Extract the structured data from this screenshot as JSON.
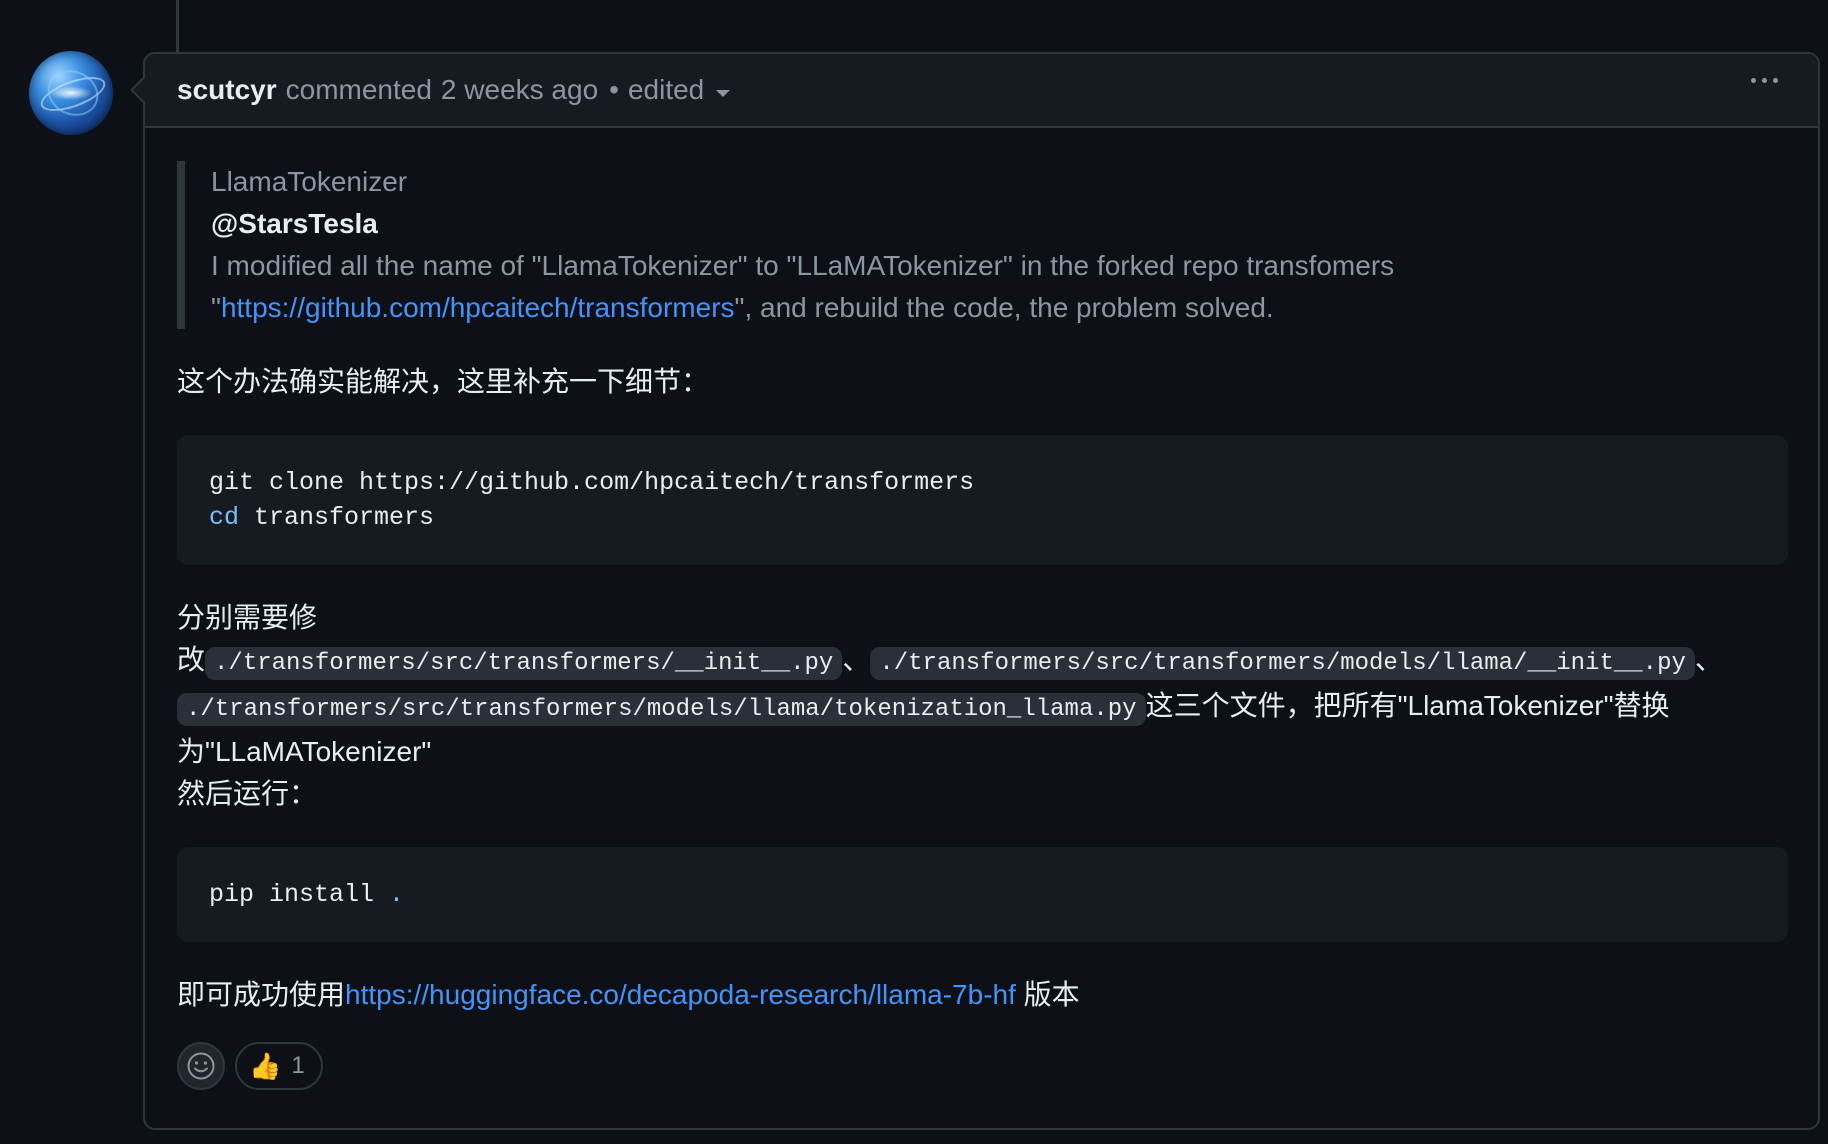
{
  "header": {
    "author": "scutcyr",
    "action": "commented",
    "time": "2 weeks ago",
    "separator": "•",
    "edited": "edited"
  },
  "quote": {
    "title": "LlamaTokenizer",
    "mention": "@StarsTesla",
    "line1": "I modified all the name of \"LlamaTokenizer\" to \"LLaMATokenizer\" in the forked repo transfomers",
    "open_quote": "\"",
    "link": "https://github.com/hpcaitech/transformers",
    "line2_rest": "\", and rebuild the code, the problem solved."
  },
  "intro": "这个办法确实能解决，这里补充一下细节：",
  "code1": {
    "line1": "git clone https://github.com/hpcaitech/transformers",
    "line2_kw": "cd",
    "line2_rest": " transformers"
  },
  "modify": {
    "prefix_line1": "分别需要修",
    "prefix_line2": "改",
    "file1": "./transformers/src/transformers/__init__.py",
    "sep": "、",
    "file2": "./transformers/src/transformers/models/llama/__init__.py",
    "file3": "./transformers/src/transformers/models/llama/tokenization_llama.py",
    "suffix": "这三个文件，把所有\"LlamaTokenizer\"替换",
    "suffix2": "为\"LLaMATokenizer\"",
    "then": "然后运行："
  },
  "code2": {
    "cmd": "pip install ",
    "dot": "."
  },
  "final": {
    "prefix": "即可成功使用",
    "link": "https://huggingface.co/decapoda-research/llama-7b-hf",
    "suffix": " 版本"
  },
  "reactions": {
    "thumbs_emoji": "👍",
    "thumbs_count": "1"
  }
}
